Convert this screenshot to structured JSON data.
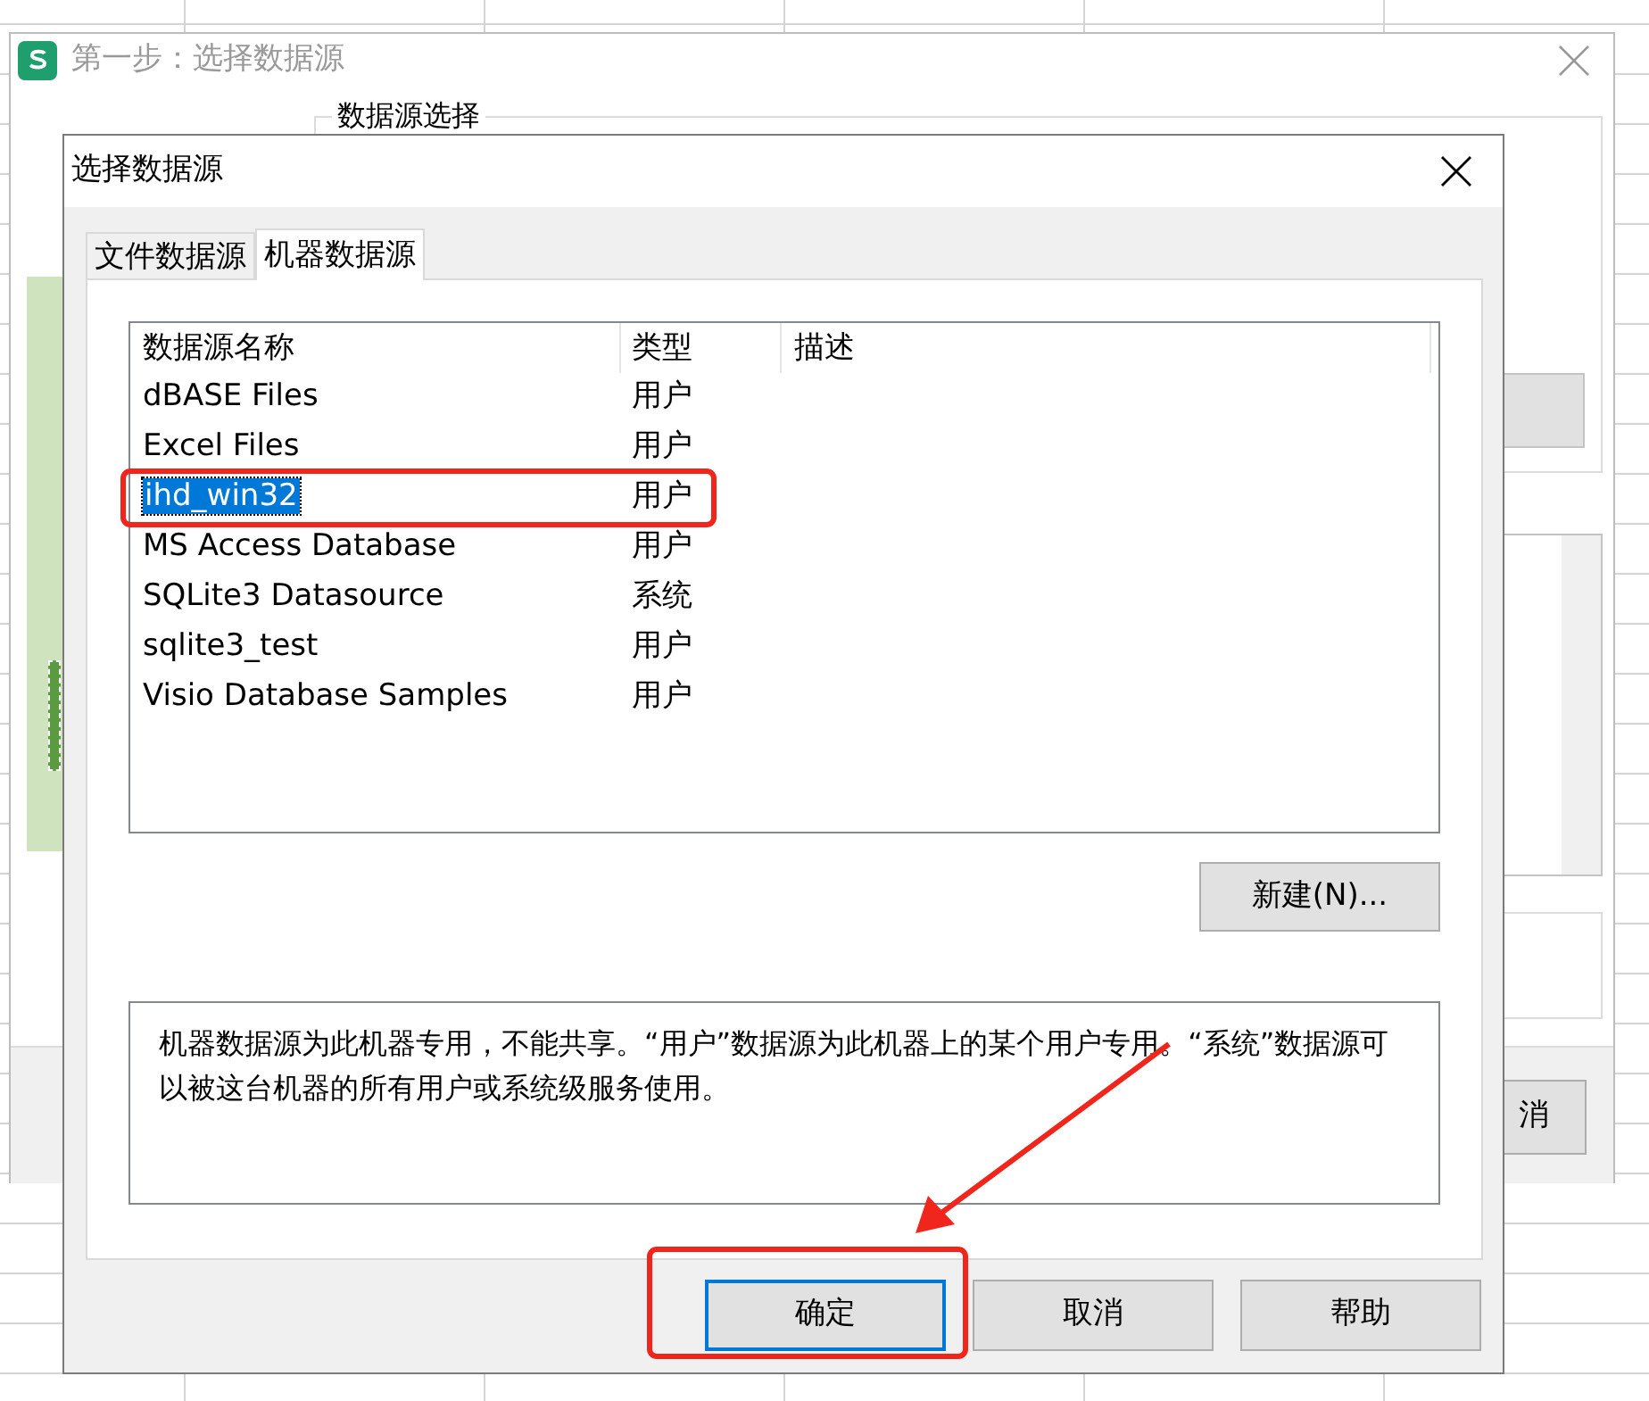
{
  "background_window": {
    "title": "第一步：选择数据源",
    "group_label": "数据源选择",
    "button_partial": "消"
  },
  "dialog": {
    "title": "选择数据源",
    "tabs": [
      {
        "label": "文件数据源",
        "selected": false
      },
      {
        "label": "机器数据源",
        "selected": true
      }
    ],
    "table": {
      "columns": [
        "数据源名称",
        "类型",
        "描述"
      ],
      "rows": [
        {
          "name": "dBASE Files",
          "type": "用户",
          "selected": false
        },
        {
          "name": "Excel Files",
          "type": "用户",
          "selected": false
        },
        {
          "name": "ihd_win32",
          "type": "用户",
          "selected": true
        },
        {
          "name": "MS Access Database",
          "type": "用户",
          "selected": false
        },
        {
          "name": "SQLite3 Datasource",
          "type": "系统",
          "selected": false
        },
        {
          "name": "sqlite3_test",
          "type": "用户",
          "selected": false
        },
        {
          "name": "Visio Database Samples",
          "type": "用户",
          "selected": false
        }
      ]
    },
    "new_button": "新建(N)...",
    "description": "机器数据源为此机器专用，不能共享。“用户”数据源为此机器上的某个用户专用。“系统”数据源可以被这台机器的所有用户或系统级服务使用。",
    "buttons": [
      {
        "label": "确定",
        "focused": true
      },
      {
        "label": "取消",
        "focused": false
      },
      {
        "label": "帮助",
        "focused": false
      }
    ]
  }
}
